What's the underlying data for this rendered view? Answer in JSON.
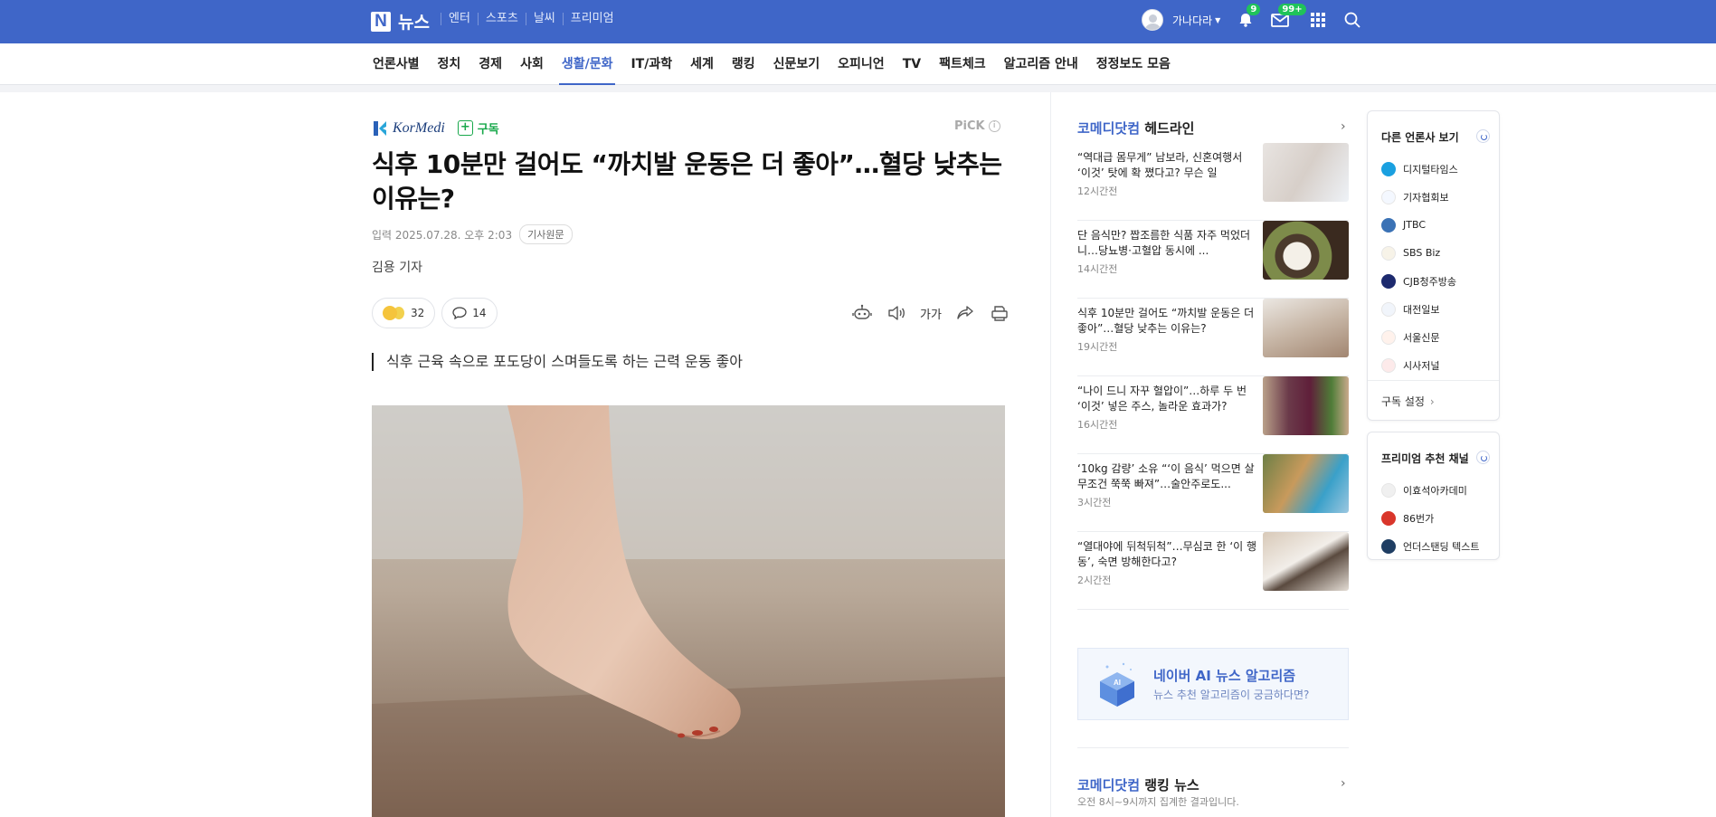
{
  "topbar": {
    "logo_mark": "N",
    "logo_text": "뉴스",
    "nav": [
      "엔터",
      "스포츠",
      "날씨",
      "프리미엄"
    ],
    "username": "가나다라",
    "notif_count": "9",
    "mail_count": "99+",
    "colors": {
      "bar": "#3f66c8",
      "badge": "#20c35a"
    }
  },
  "catnav": {
    "items": [
      "언론사별",
      "정치",
      "경제",
      "사회",
      "생활/문화",
      "IT/과학",
      "세계",
      "랭킹",
      "신문보기",
      "오피니언",
      "TV",
      "팩트체크",
      "알고리즘 안내",
      "정정보도 모음"
    ],
    "active": "생활/문화"
  },
  "article": {
    "press": "KorMedi",
    "subscribe_label": "구독",
    "pick_label": "PiCK",
    "title": "식후 10분만 걸어도 “까치발 운동은 더 좋아”…혈당 낮추는 이유는?",
    "date": "입력 2025.07.28. 오후 2:03",
    "original_button": "기사원문",
    "author": "김용 기자",
    "reaction_count": "32",
    "comment_count": "14",
    "text_size_label": "가가",
    "summary": "식후 근육 속으로 포도당이 스며들도록 하는 근력 운동 좋아"
  },
  "headlines": {
    "press_name": "코메디닷컴",
    "title_suffix": "헤드라인",
    "items": [
      {
        "title": "“역대급 몸무게” 남보라, 신혼여행서 ‘이것’ 탓에 확 쪘다고? 무슨 일",
        "time": "12시간전"
      },
      {
        "title": "단 음식만? 짭조름한 식품 자주 먹었더니…당뇨병·고혈압 동시에 ...",
        "time": "14시간전"
      },
      {
        "title": "식후 10분만 걸어도 “까치발 운동은 더 좋아”…혈당 낮추는 이유는?",
        "time": "19시간전"
      },
      {
        "title": "“나이 드니 자꾸 혈압이”…하루 두 번 ‘이것’ 넣은 주스, 놀라운 효과가?",
        "time": "16시간전"
      },
      {
        "title": "‘10kg 감량’ 소유 “‘이 음식’ 먹으면 살 무조건 쭉쭉 빠져”…술안주로도...",
        "time": "3시간전"
      },
      {
        "title": "“열대야에 뒤척뒤척”…무심코 한 ‘이 행동’, 숙면 방해한다고?",
        "time": "2시간전"
      }
    ]
  },
  "ai_banner": {
    "title": "네이버 AI 뉴스 알고리즘",
    "subtitle": "뉴스 추천 알고리즘이 궁금하다면?"
  },
  "ranking": {
    "press_name": "코메디닷컴",
    "title_suffix": "랭킹 뉴스",
    "subtitle": "오전 8시~9시까지 집계한 결과입니다."
  },
  "other_press": {
    "title": "다른 언론사 보기",
    "items": [
      "디지털타임스",
      "기자협회보",
      "JTBC",
      "SBS Biz",
      "CJB청주방송",
      "대전일보",
      "서울신문",
      "시사저널"
    ],
    "footer": "구독 설정"
  },
  "premium": {
    "title": "프리미엄 추천 채널",
    "items": [
      "이효석아카데미",
      "86번가",
      "언더스탠딩 텍스트"
    ]
  }
}
